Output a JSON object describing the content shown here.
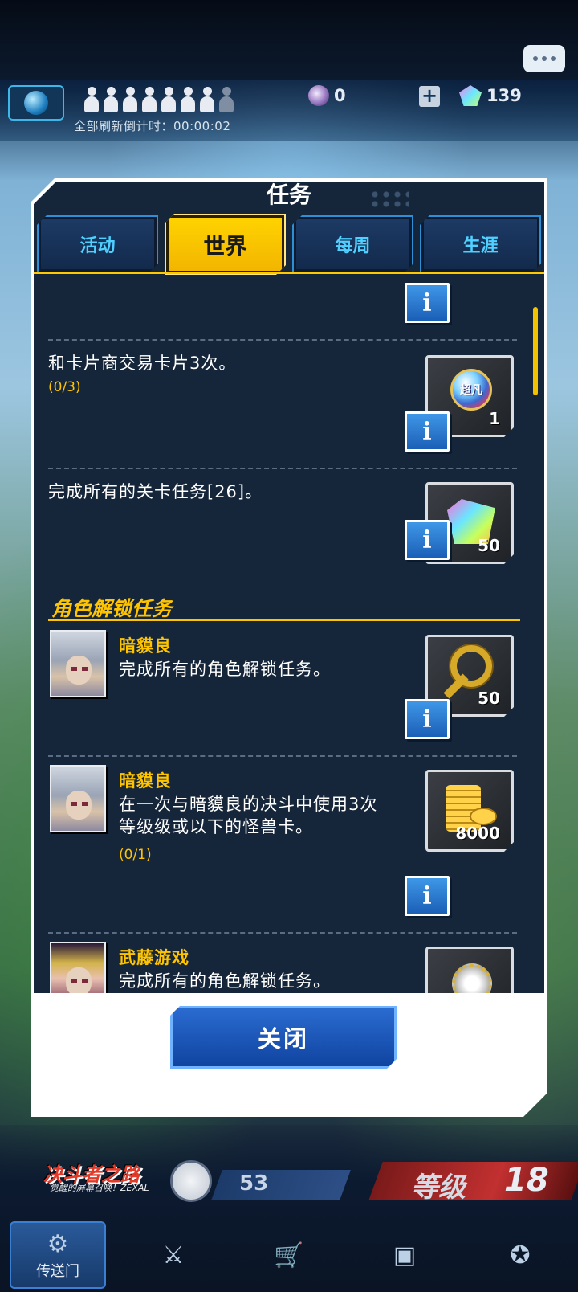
{
  "header": {
    "refresh_countdown": "全部刷新倒计时：00:00:02",
    "orb_count": "0",
    "gem_count": "139"
  },
  "modal": {
    "title": "任务",
    "tabs": [
      {
        "label": "活动",
        "active": false
      },
      {
        "label": "世界",
        "active": true
      },
      {
        "label": "每周",
        "active": false
      },
      {
        "label": "生涯",
        "active": false
      }
    ],
    "info_label": "i",
    "missions": [
      {
        "text": "和卡片商交易卡片3次。",
        "progress": "(0/3)",
        "reward_icon": "super-rare-orb-icon",
        "reward_label": "超凡",
        "reward_qty": "1"
      },
      {
        "text": "完成所有的关卡任务[26]。",
        "progress": "",
        "reward_icon": "gem-icon",
        "reward_qty": "50"
      }
    ],
    "section_title": "角色解锁任务",
    "character_missions": [
      {
        "name": "暗貘良",
        "desc": "完成所有的角色解锁任务。",
        "progress": "",
        "reward_icon": "gate-key-icon",
        "reward_qty": "50"
      },
      {
        "name": "暗貘良",
        "desc": "在一次与暗貘良的决斗中使用3次等级级或以下的怪兽卡。",
        "desc_line1": "在一次与暗貘良的决斗中使用3次",
        "desc_line2": "等级级或以下的怪兽卡。",
        "progress": "(0/1)",
        "reward_icon": "gold-coins-icon",
        "reward_qty": "8000"
      },
      {
        "name": "武藤游戏",
        "desc": "完成所有的角色解锁任务。",
        "progress": "",
        "reward_icon": "gear-medal-icon",
        "reward_qty": ""
      }
    ],
    "close_label": "关闭"
  },
  "bottom": {
    "logo": "决斗者之路",
    "logo_sub": "觉醒的屏幕召唤！ZEXAL",
    "level_value": "53",
    "rank_label": "等级",
    "rank_value": "18",
    "nav": [
      {
        "label": "传送门",
        "icon": "portal-icon",
        "active": true
      },
      {
        "label": "",
        "icon": "crossed-swords-icon",
        "active": false
      },
      {
        "label": "",
        "icon": "shopping-cart-icon",
        "active": false
      },
      {
        "label": "",
        "icon": "cards-icon",
        "active": false
      },
      {
        "label": "",
        "icon": "duelist-gear-icon",
        "active": false
      }
    ]
  },
  "colors": {
    "accent_yellow": "#ffc400",
    "tab_cyan": "#4fd0ff",
    "panel_dark": "#16263a",
    "button_blue": "#1b5fb7"
  }
}
